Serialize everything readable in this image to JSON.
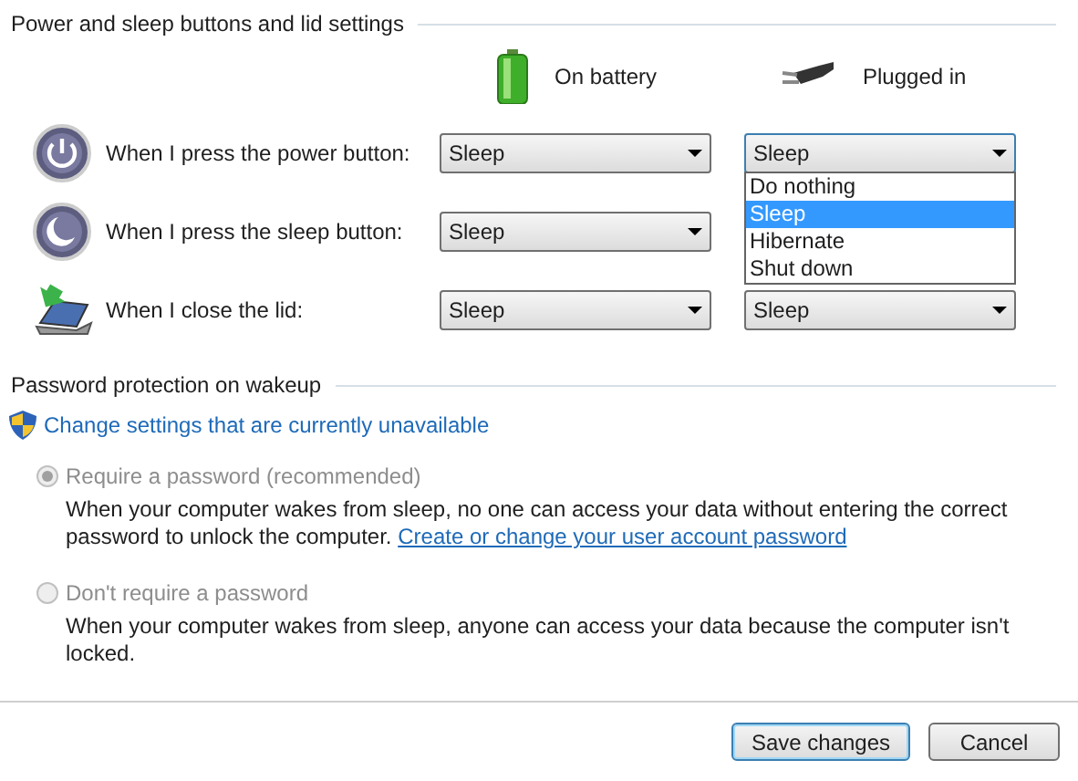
{
  "power_section": {
    "title": "Power and sleep buttons and lid settings",
    "columns": [
      {
        "kind": "battery",
        "label": "On battery"
      },
      {
        "kind": "plug",
        "label": "Plugged in"
      }
    ],
    "rows": [
      {
        "kind": "power",
        "label": "When I press the power button:",
        "selects": [
          {
            "value": "Sleep",
            "expanded": false
          },
          {
            "value": "Sleep",
            "expanded": true,
            "options": [
              {
                "label": "Do nothing",
                "selected": false
              },
              {
                "label": "Sleep",
                "selected": true
              },
              {
                "label": "Hibernate",
                "selected": false
              },
              {
                "label": "Shut down",
                "selected": false
              }
            ]
          }
        ]
      },
      {
        "kind": "sleep",
        "label": "When I press the sleep button:",
        "selects": [
          {
            "value": "Sleep",
            "expanded": false
          }
        ]
      },
      {
        "kind": "lid",
        "label": "When I close the lid:",
        "selects": [
          {
            "value": "Sleep",
            "expanded": false
          },
          {
            "value": "Sleep",
            "expanded": false
          }
        ]
      }
    ]
  },
  "password_section": {
    "title": "Password protection on wakeup",
    "link": "Change settings that are currently unavailable",
    "options": [
      {
        "label": "Require a password (recommended)",
        "selected": true,
        "disabled": true,
        "description": "When your computer wakes from sleep, no one can access your data without entering the correct password to unlock the computer.",
        "link": "Create or change your user account password"
      },
      {
        "label": "Don't require a password",
        "selected": false,
        "disabled": true,
        "description": "When your computer wakes from sleep, anyone can access your data because the computer isn't locked."
      }
    ]
  },
  "buttons": [
    {
      "label": "Save changes",
      "default": true
    },
    {
      "label": "Cancel",
      "default": false
    }
  ]
}
